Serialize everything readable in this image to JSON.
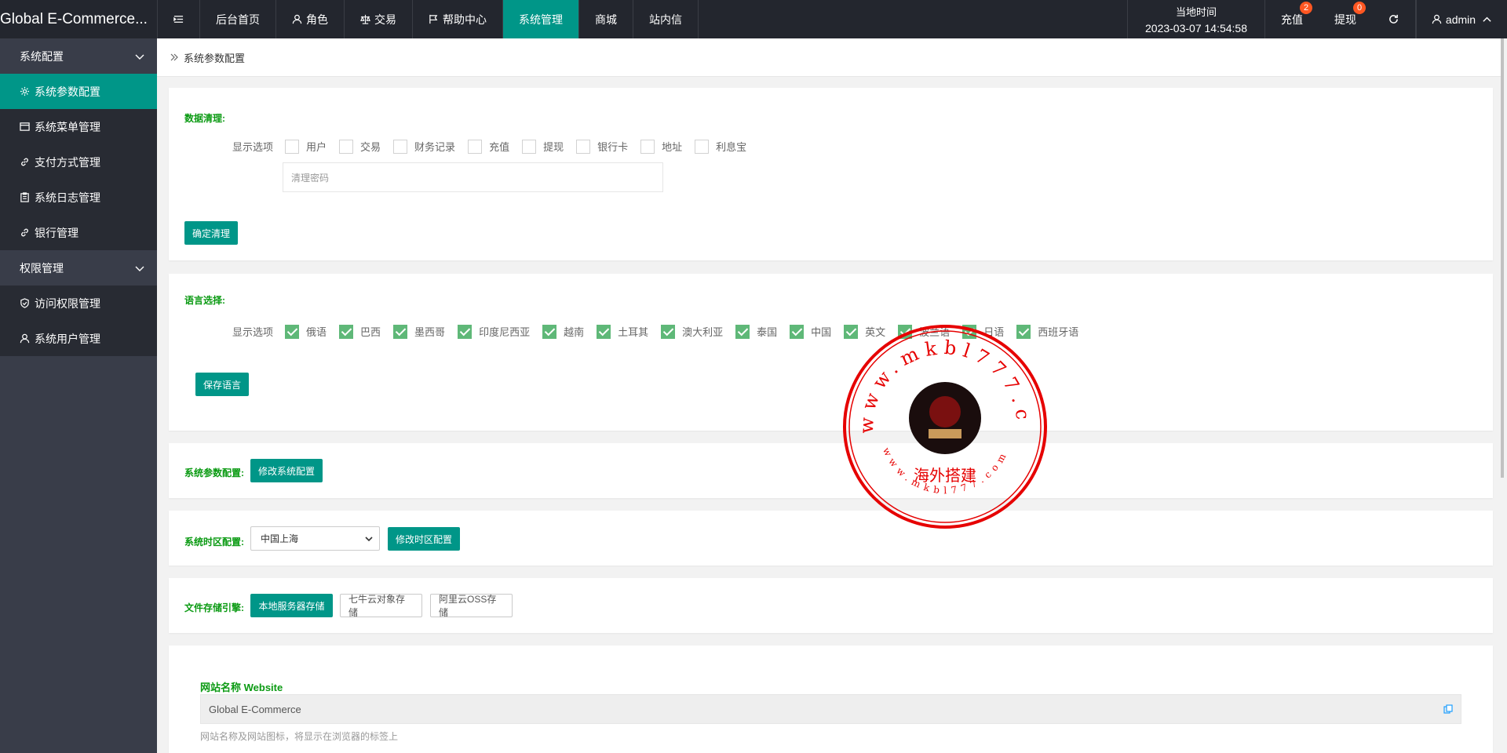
{
  "app": {
    "title": "Global E-Commerce..."
  },
  "topnav": {
    "items": [
      {
        "label": "后台首页",
        "icon": ""
      },
      {
        "label": "角色",
        "icon": "user-icon"
      },
      {
        "label": "交易",
        "icon": "scale-icon"
      },
      {
        "label": "帮助中心",
        "icon": "flag-icon"
      },
      {
        "label": "系统管理",
        "icon": "",
        "active": true
      },
      {
        "label": "商城",
        "icon": ""
      },
      {
        "label": "站内信",
        "icon": ""
      }
    ],
    "time_label": "当地时间",
    "time_value": "2023-03-07 14:54:58",
    "recharge": {
      "label": "充值",
      "badge": "2"
    },
    "withdraw": {
      "label": "提现",
      "badge": "0"
    },
    "user": "admin",
    "badge_color": "#ff5722"
  },
  "sidebar": {
    "groups": [
      {
        "label": "系统配置",
        "items": [
          {
            "label": "系统参数配置",
            "icon": "gear-icon",
            "active": true
          },
          {
            "label": "系统菜单管理",
            "icon": "menu-icon"
          },
          {
            "label": "支付方式管理",
            "icon": "link-icon"
          },
          {
            "label": "系统日志管理",
            "icon": "clipboard-icon"
          },
          {
            "label": "银行管理",
            "icon": "link-icon"
          }
        ]
      },
      {
        "label": "权限管理",
        "items": [
          {
            "label": "访问权限管理",
            "icon": "shield-icon"
          },
          {
            "label": "系统用户管理",
            "icon": "user-icon"
          }
        ]
      }
    ]
  },
  "breadcrumb": "系统参数配置",
  "data_clean": {
    "title": "数据清理:",
    "row_label": "显示选项",
    "options": [
      "用户",
      "交易",
      "财务记录",
      "充值",
      "提现",
      "银行卡",
      "地址",
      "利息宝"
    ],
    "password_placeholder": "清理密码",
    "submit": "确定清理"
  },
  "language": {
    "title": "语言选择:",
    "row_label": "显示选项",
    "options": [
      "俄语",
      "巴西",
      "墨西哥",
      "印度尼西亚",
      "越南",
      "土耳其",
      "澳大利亚",
      "泰国",
      "中国",
      "英文",
      "波兰语",
      "日语",
      "西班牙语"
    ],
    "save": "保存语言"
  },
  "sys_params": {
    "title": "系统参数配置:",
    "button": "修改系统配置"
  },
  "timezone": {
    "title": "系统时区配置:",
    "value": "中国上海",
    "button": "修改时区配置"
  },
  "storage": {
    "title": "文件存储引擎:",
    "options": [
      "本地服务器存储",
      "七牛云对象存储",
      "阿里云OSS存储"
    ],
    "active_index": 0
  },
  "website": {
    "label": "网站名称 Website",
    "value": "Global E-Commerce",
    "help": "网站名称及网站图标，将显示在浏览器的标签上"
  },
  "watermark": {
    "top_text": "www.mkbl777.com",
    "center_text": "海外搭建",
    "bottom_text": "www.mkbl777.com",
    "color": "#e60000"
  },
  "colors": {
    "accent": "#009688",
    "header_bg": "#23262e",
    "sidebar_bg": "#393d49",
    "section_title": "#0a9a12",
    "checked": "#5fb878"
  }
}
